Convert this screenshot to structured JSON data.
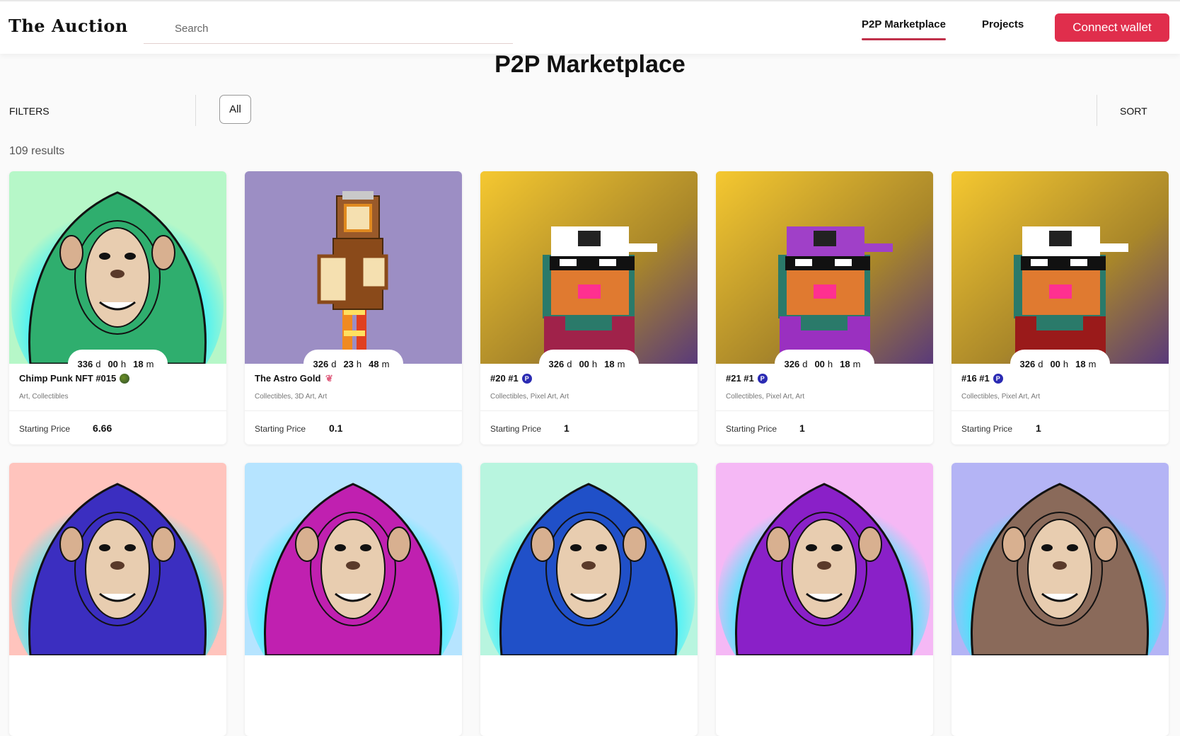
{
  "header": {
    "logo": "The Auction",
    "search_placeholder": "Search",
    "nav": [
      "P2P Marketplace",
      "Projects"
    ],
    "connect_label": "Connect wallet"
  },
  "page": {
    "title": "P2P Marketplace",
    "filters_label": "FILTERS",
    "filter_chip": "All",
    "sort_label": "SORT",
    "results": "109 results"
  },
  "cards": [
    {
      "title": "Chimp Punk NFT #015",
      "cats": "Art, Collectibles",
      "price_label": "Starting Price",
      "price": "6.66",
      "d": "336",
      "h": "00",
      "m": "18",
      "bg": "#b6f7c8",
      "kind": "chimp",
      "fur": "#2fae6e"
    },
    {
      "title": "The Astro Gold",
      "cats": "Collectibles, 3D Art, Art",
      "price_label": "Starting Price",
      "price": "0.1",
      "d": "326",
      "h": "23",
      "m": "48",
      "bg": "#9c8ec4",
      "kind": "astro"
    },
    {
      "title": "#20 #1",
      "cats": "Collectibles, Pixel Art, Art",
      "price_label": "Starting Price",
      "price": "1",
      "d": "326",
      "h": "00",
      "m": "18",
      "bg": "#c9a32a",
      "kind": "pixel",
      "cap": "#ffffff",
      "shirt": "#a0224a"
    },
    {
      "title": "#21 #1",
      "cats": "Collectibles, Pixel Art, Art",
      "price_label": "Starting Price",
      "price": "1",
      "d": "326",
      "h": "00",
      "m": "18",
      "bg": "#c9a32a",
      "kind": "pixel",
      "cap": "#a040c8",
      "shirt": "#9a30c0"
    },
    {
      "title": "#16 #1",
      "cats": "Collectibles, Pixel Art, Art",
      "price_label": "Starting Price",
      "price": "1",
      "d": "326",
      "h": "00",
      "m": "18",
      "bg": "#c9a32a",
      "kind": "pixel",
      "cap": "#ffffff",
      "shirt": "#9a1a1a"
    },
    {
      "bg": "#ffc4bd",
      "kind": "chimp",
      "fur": "#3b2ec0"
    },
    {
      "bg": "#b6e4ff",
      "kind": "chimp",
      "fur": "#c020b0"
    },
    {
      "bg": "#b8f5df",
      "kind": "chimp",
      "fur": "#2050c8"
    },
    {
      "bg": "#f5b8f5",
      "kind": "chimp",
      "fur": "#8a20c8"
    },
    {
      "bg": "#b4b4f5",
      "kind": "chimp",
      "fur": "#8a6a5a"
    }
  ]
}
